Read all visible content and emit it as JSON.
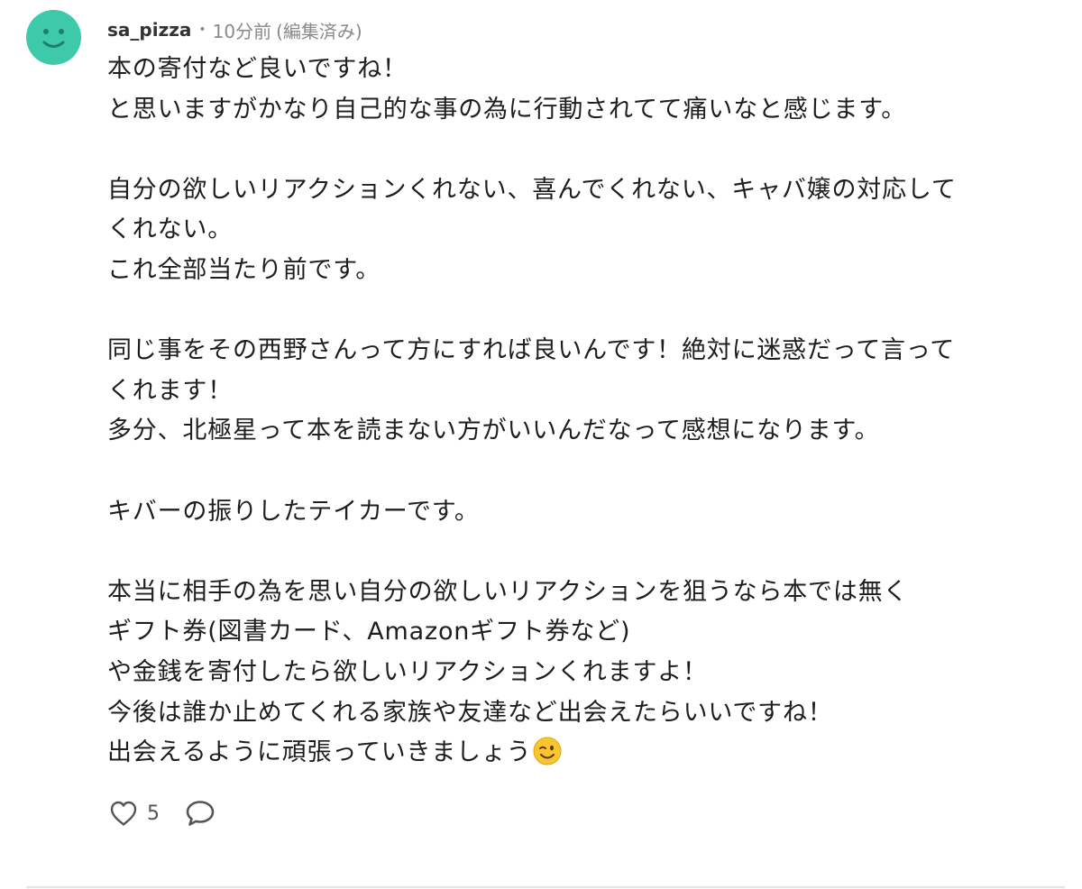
{
  "comment": {
    "username": "sa_pizza",
    "separator": "•",
    "time": "10分前",
    "edited": "(編集済み)",
    "avatar_color": "#3ec9ab",
    "avatar_icon": "smiley-face-icon",
    "lines": [
      "本の寄付など良いですね！",
      "と思いますがかなり自己的な事の為に行動されてて痛いなと感じます。",
      "",
      "自分の欲しいリアクションくれない、喜んでくれない、キャバ嬢の対応して",
      "くれない。",
      "これ全部当たり前です。",
      "",
      "同じ事をその西野さんって方にすれば良いんです！絶対に迷惑だって言って",
      "くれます！",
      "多分、北極星って本を読まない方がいいんだなって感想になります。",
      "",
      "キバーの振りしたテイカーです。",
      "",
      "本当に相手の為を思い自分の欲しいリアクションを狙うなら本では無く",
      "ギフト券(図書カード、Amazonギフト券など)",
      "や金銭を寄付したら欲しいリアクションくれますよ！",
      "今後は誰か止めてくれる家族や友達など出会えたらいいですね！",
      "出会えるように頑張っていきましょう"
    ],
    "trailing_emoji": "winking-face-emoji",
    "likes": "5",
    "like_icon": "heart-outline-icon",
    "reply_icon": "speech-bubble-icon"
  }
}
